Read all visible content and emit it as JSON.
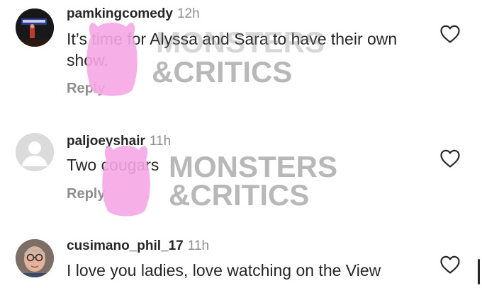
{
  "comments": [
    {
      "username": "pamkingcomedy",
      "time": "12h",
      "text": "It’s time for Alyssa and Sara to have their own show.",
      "reply": "Reply",
      "avatar": "stage-photo"
    },
    {
      "username": "paljoeyshair",
      "time": "11h",
      "text": "Two cougars",
      "reply": "Reply",
      "avatar": "default-profile"
    },
    {
      "username": "cusimano_phil_17",
      "time": "11h",
      "text": "I love you ladies, love watching on the View",
      "avatar": "man-with-glasses-photo"
    }
  ],
  "watermark": {
    "line1": "MONSTERS",
    "line2": "&CRITICS",
    "mascot_color": "#f6a6e6"
  },
  "icons": {
    "like": "heart-outline-icon"
  }
}
